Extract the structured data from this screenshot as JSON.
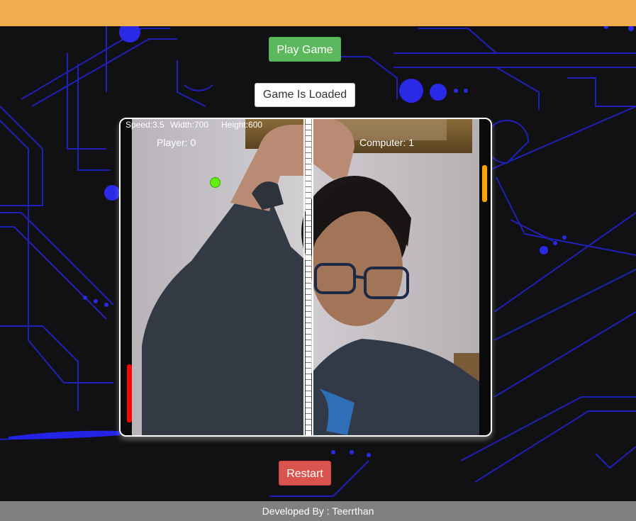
{
  "header": {
    "bar_color": "#f0ad4e"
  },
  "controls": {
    "play_label": "Play Game",
    "status_label": "Game Is Loaded",
    "restart_label": "Restart"
  },
  "game": {
    "info": {
      "speed": "Speed:3.5",
      "width": "Width:700",
      "height": "Height:600"
    },
    "player": {
      "label": "Player:",
      "score": "0",
      "paddle_color": "#ff0000"
    },
    "computer": {
      "label": "Computer:",
      "score": "1",
      "paddle_color": "#ffa500"
    },
    "ball_color": "#66ee11"
  },
  "footer": {
    "text": "Developed By : Teerrthan"
  },
  "colors": {
    "background": "#111114",
    "circuit_lines": "#2a2ae0",
    "play_button": "#5cb85c",
    "restart_button": "#d9534f",
    "footer": "#808080"
  }
}
